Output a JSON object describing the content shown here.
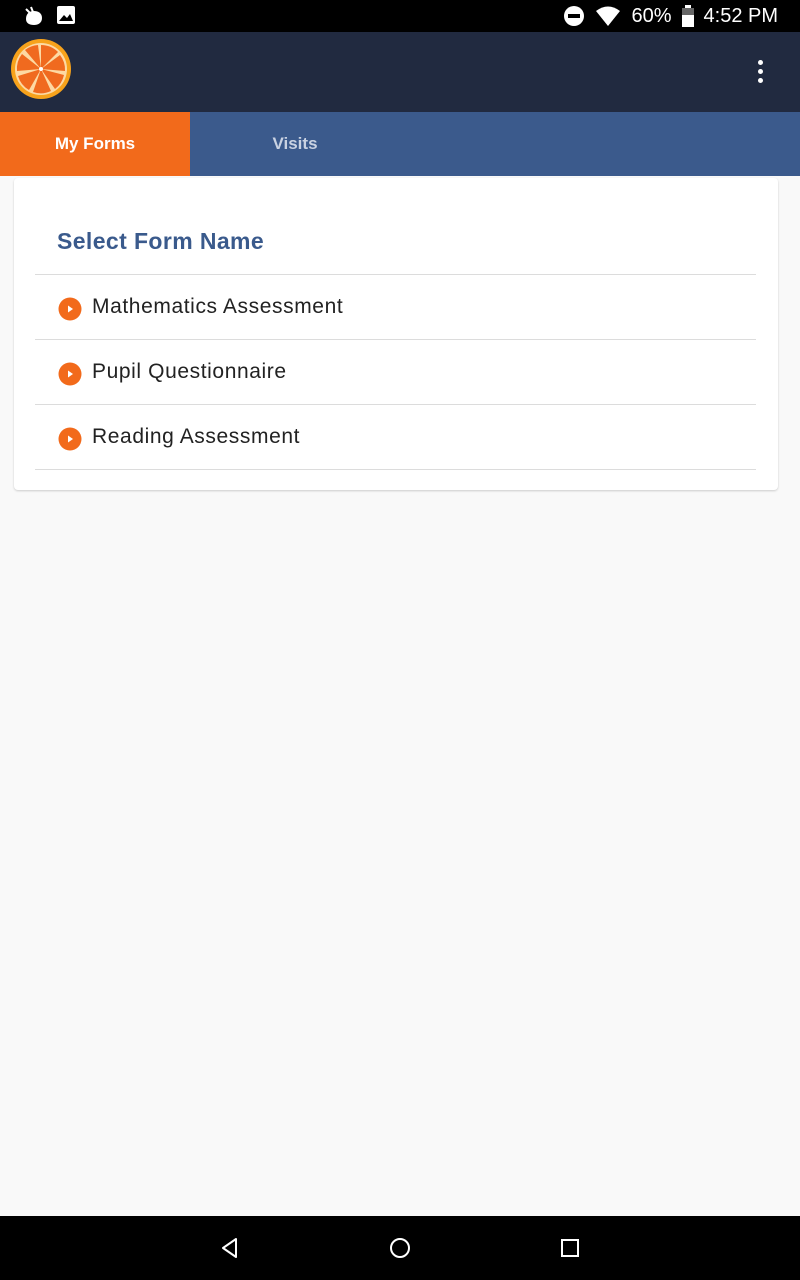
{
  "status_bar": {
    "battery_percent": "60%",
    "time": "4:52 PM",
    "icons": [
      "notification-app-icon",
      "image-notification-icon",
      "do-not-disturb-icon",
      "wifi-icon",
      "battery-icon"
    ]
  },
  "app_bar": {
    "logo": "orange-slice-logo",
    "overflow_icon": "more-vert-icon"
  },
  "tabs": [
    {
      "label": "My Forms",
      "active": true
    },
    {
      "label": "Visits",
      "active": false
    }
  ],
  "card": {
    "title": "Select Form Name",
    "forms": [
      {
        "label": "Mathematics Assessment",
        "icon": "play-circle-icon"
      },
      {
        "label": "Pupil Questionnaire",
        "icon": "play-circle-icon"
      },
      {
        "label": "Reading Assessment",
        "icon": "play-circle-icon"
      }
    ]
  },
  "nav_bar": {
    "buttons": [
      "back-icon",
      "home-icon",
      "recents-icon"
    ]
  },
  "colors": {
    "app_bar": "#212a40",
    "tab_bar": "#3b5a8c",
    "tab_active": "#f26a1b",
    "title_text": "#3a5a8c",
    "accent": "#f26a1b",
    "background": "#f9f9f9"
  }
}
